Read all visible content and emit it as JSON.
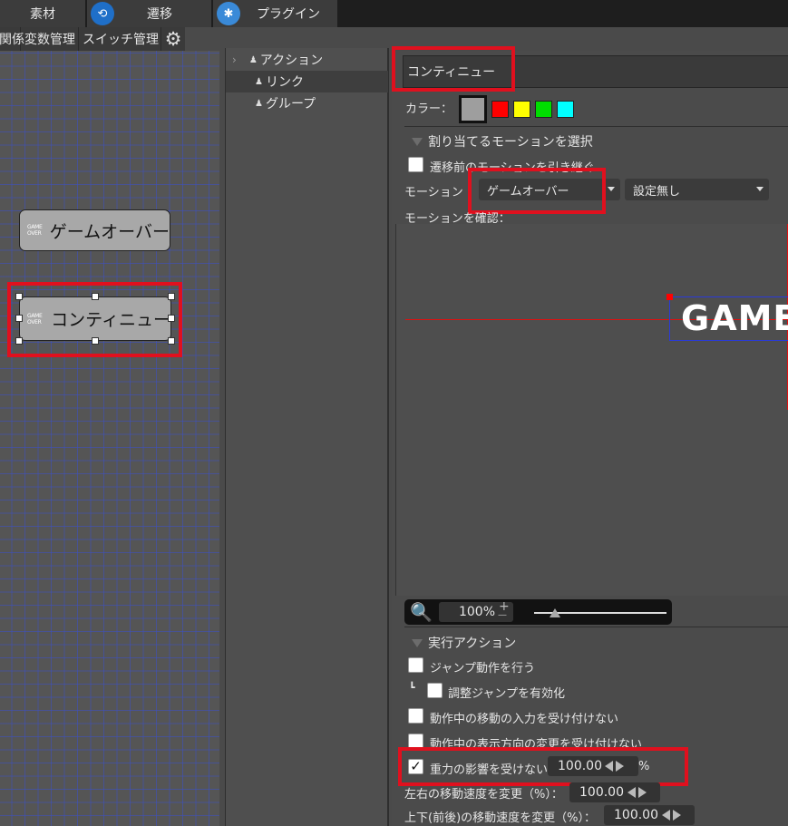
{
  "top_tabs": [
    {
      "label": "素材",
      "icon": "none"
    },
    {
      "label": "遷移",
      "icon": "transition-icon"
    },
    {
      "label": "プラグイン",
      "icon": "plugin-icon"
    }
  ],
  "subbar": {
    "items": [
      "関係",
      "変数管理",
      "スイッチ管理"
    ],
    "settings_icon": "gear-icon"
  },
  "canvas": {
    "nodes": [
      {
        "thumb": "GAME OVER",
        "label": "ゲームオーバー",
        "selected": false
      },
      {
        "thumb": "GAME OVER",
        "label": "コンティニュー",
        "selected": true
      }
    ]
  },
  "tree": {
    "items": [
      {
        "label": "アクション",
        "expandable": true
      },
      {
        "label": "リンク",
        "selected": true
      },
      {
        "label": "グループ"
      }
    ]
  },
  "properties": {
    "name": "コンティニュー",
    "color_label": "カラー：",
    "colors": [
      "#a0a0a0",
      "#ff0000",
      "#ffff00",
      "#00dd00",
      "#00ffff"
    ],
    "motion_section": "割り当てるモーションを選択",
    "inherit_checkbox": "遷移前のモーションを引き継ぐ",
    "motion_label": "モーション",
    "motion_value": "ゲームオーバー",
    "motion_setting": "設定無し",
    "confirm_label": "モーションを確認：",
    "preview_text": "GAME",
    "zoom_value": "100%",
    "zoom_plus": "+",
    "zoom_minus": "—",
    "zoom_slider_fraction": 0.16,
    "action_section": "実行アクション",
    "actions": {
      "jump": "ジャンプ動作を行う",
      "adjust_jump_prefix": "┗",
      "adjust_jump": "調整ジャンプを有効化",
      "ignore_move_input": "動作中の移動の入力を受け付けない",
      "ignore_direction": "動作中の表示方向の変更を受け付けない",
      "gravity": "重力の影響を受けない",
      "gravity_value": "100.00",
      "gravity_unit": "%",
      "gravity_checked": true,
      "horizontal_speed_label": "左右の移動速度を変更（%）：",
      "horizontal_speed_value": "100.00",
      "vertical_speed_label": "上下(前後)の移動速度を変更（%）：",
      "vertical_speed_value": "100.00"
    }
  }
}
